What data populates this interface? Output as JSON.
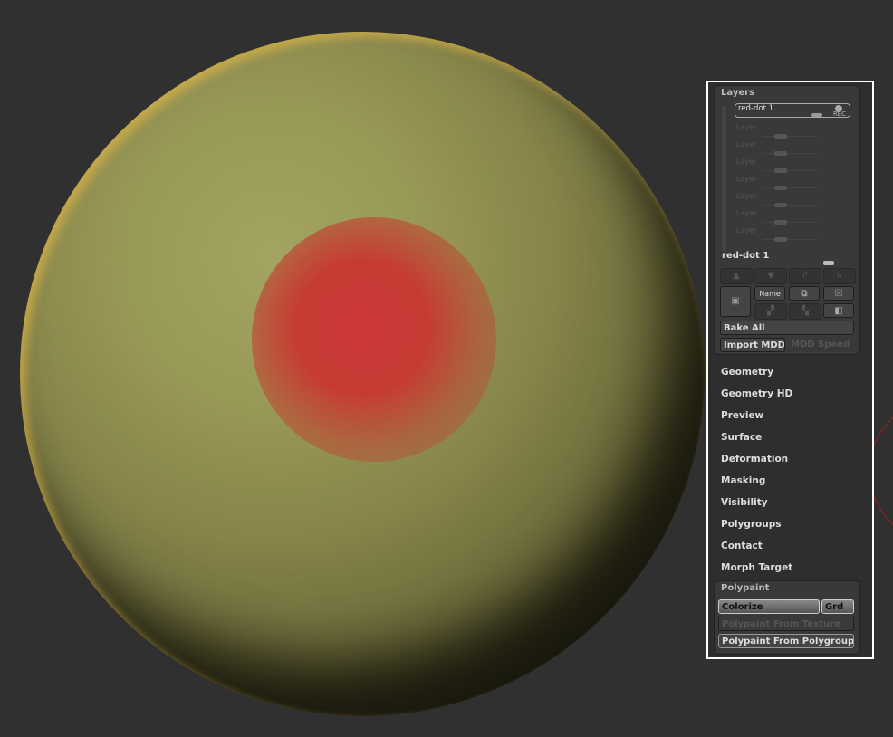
{
  "layers": {
    "title": "Layers",
    "active_layer": "red-dot 1",
    "rec_label": "REC",
    "empty_layers": [
      "Layer",
      "Layer",
      "Layer",
      "Layer",
      "Layer",
      "Layer",
      "Layer"
    ],
    "selected_name": "red-dot 1",
    "name_button": "Name",
    "bake_all": "Bake All",
    "import_mdd": "Import MDD",
    "mdd_speed": "MDD Speed"
  },
  "menu": [
    "Geometry",
    "Geometry HD",
    "Preview",
    "Surface",
    "Deformation",
    "Masking",
    "Visibility",
    "Polygroups",
    "Contact",
    "Morph Target"
  ],
  "polypaint": {
    "title": "Polypaint",
    "colorize": "Colorize",
    "grd": "Grd",
    "from_texture": "Polypaint From Texture",
    "from_polygroups": "Polypaint From Polygroups"
  }
}
